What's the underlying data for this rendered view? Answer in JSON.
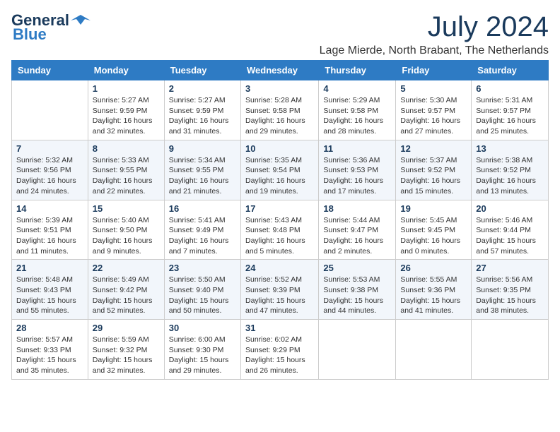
{
  "logo": {
    "line1": "General",
    "line2": "Blue"
  },
  "title": "July 2024",
  "location": "Lage Mierde, North Brabant, The Netherlands",
  "days_of_week": [
    "Sunday",
    "Monday",
    "Tuesday",
    "Wednesday",
    "Thursday",
    "Friday",
    "Saturday"
  ],
  "weeks": [
    [
      {
        "day": "",
        "info": ""
      },
      {
        "day": "1",
        "info": "Sunrise: 5:27 AM\nSunset: 9:59 PM\nDaylight: 16 hours\nand 32 minutes."
      },
      {
        "day": "2",
        "info": "Sunrise: 5:27 AM\nSunset: 9:59 PM\nDaylight: 16 hours\nand 31 minutes."
      },
      {
        "day": "3",
        "info": "Sunrise: 5:28 AM\nSunset: 9:58 PM\nDaylight: 16 hours\nand 29 minutes."
      },
      {
        "day": "4",
        "info": "Sunrise: 5:29 AM\nSunset: 9:58 PM\nDaylight: 16 hours\nand 28 minutes."
      },
      {
        "day": "5",
        "info": "Sunrise: 5:30 AM\nSunset: 9:57 PM\nDaylight: 16 hours\nand 27 minutes."
      },
      {
        "day": "6",
        "info": "Sunrise: 5:31 AM\nSunset: 9:57 PM\nDaylight: 16 hours\nand 25 minutes."
      }
    ],
    [
      {
        "day": "7",
        "info": "Sunrise: 5:32 AM\nSunset: 9:56 PM\nDaylight: 16 hours\nand 24 minutes."
      },
      {
        "day": "8",
        "info": "Sunrise: 5:33 AM\nSunset: 9:55 PM\nDaylight: 16 hours\nand 22 minutes."
      },
      {
        "day": "9",
        "info": "Sunrise: 5:34 AM\nSunset: 9:55 PM\nDaylight: 16 hours\nand 21 minutes."
      },
      {
        "day": "10",
        "info": "Sunrise: 5:35 AM\nSunset: 9:54 PM\nDaylight: 16 hours\nand 19 minutes."
      },
      {
        "day": "11",
        "info": "Sunrise: 5:36 AM\nSunset: 9:53 PM\nDaylight: 16 hours\nand 17 minutes."
      },
      {
        "day": "12",
        "info": "Sunrise: 5:37 AM\nSunset: 9:52 PM\nDaylight: 16 hours\nand 15 minutes."
      },
      {
        "day": "13",
        "info": "Sunrise: 5:38 AM\nSunset: 9:52 PM\nDaylight: 16 hours\nand 13 minutes."
      }
    ],
    [
      {
        "day": "14",
        "info": "Sunrise: 5:39 AM\nSunset: 9:51 PM\nDaylight: 16 hours\nand 11 minutes."
      },
      {
        "day": "15",
        "info": "Sunrise: 5:40 AM\nSunset: 9:50 PM\nDaylight: 16 hours\nand 9 minutes."
      },
      {
        "day": "16",
        "info": "Sunrise: 5:41 AM\nSunset: 9:49 PM\nDaylight: 16 hours\nand 7 minutes."
      },
      {
        "day": "17",
        "info": "Sunrise: 5:43 AM\nSunset: 9:48 PM\nDaylight: 16 hours\nand 5 minutes."
      },
      {
        "day": "18",
        "info": "Sunrise: 5:44 AM\nSunset: 9:47 PM\nDaylight: 16 hours\nand 2 minutes."
      },
      {
        "day": "19",
        "info": "Sunrise: 5:45 AM\nSunset: 9:45 PM\nDaylight: 16 hours\nand 0 minutes."
      },
      {
        "day": "20",
        "info": "Sunrise: 5:46 AM\nSunset: 9:44 PM\nDaylight: 15 hours\nand 57 minutes."
      }
    ],
    [
      {
        "day": "21",
        "info": "Sunrise: 5:48 AM\nSunset: 9:43 PM\nDaylight: 15 hours\nand 55 minutes."
      },
      {
        "day": "22",
        "info": "Sunrise: 5:49 AM\nSunset: 9:42 PM\nDaylight: 15 hours\nand 52 minutes."
      },
      {
        "day": "23",
        "info": "Sunrise: 5:50 AM\nSunset: 9:40 PM\nDaylight: 15 hours\nand 50 minutes."
      },
      {
        "day": "24",
        "info": "Sunrise: 5:52 AM\nSunset: 9:39 PM\nDaylight: 15 hours\nand 47 minutes."
      },
      {
        "day": "25",
        "info": "Sunrise: 5:53 AM\nSunset: 9:38 PM\nDaylight: 15 hours\nand 44 minutes."
      },
      {
        "day": "26",
        "info": "Sunrise: 5:55 AM\nSunset: 9:36 PM\nDaylight: 15 hours\nand 41 minutes."
      },
      {
        "day": "27",
        "info": "Sunrise: 5:56 AM\nSunset: 9:35 PM\nDaylight: 15 hours\nand 38 minutes."
      }
    ],
    [
      {
        "day": "28",
        "info": "Sunrise: 5:57 AM\nSunset: 9:33 PM\nDaylight: 15 hours\nand 35 minutes."
      },
      {
        "day": "29",
        "info": "Sunrise: 5:59 AM\nSunset: 9:32 PM\nDaylight: 15 hours\nand 32 minutes."
      },
      {
        "day": "30",
        "info": "Sunrise: 6:00 AM\nSunset: 9:30 PM\nDaylight: 15 hours\nand 29 minutes."
      },
      {
        "day": "31",
        "info": "Sunrise: 6:02 AM\nSunset: 9:29 PM\nDaylight: 15 hours\nand 26 minutes."
      },
      {
        "day": "",
        "info": ""
      },
      {
        "day": "",
        "info": ""
      },
      {
        "day": "",
        "info": ""
      }
    ]
  ]
}
